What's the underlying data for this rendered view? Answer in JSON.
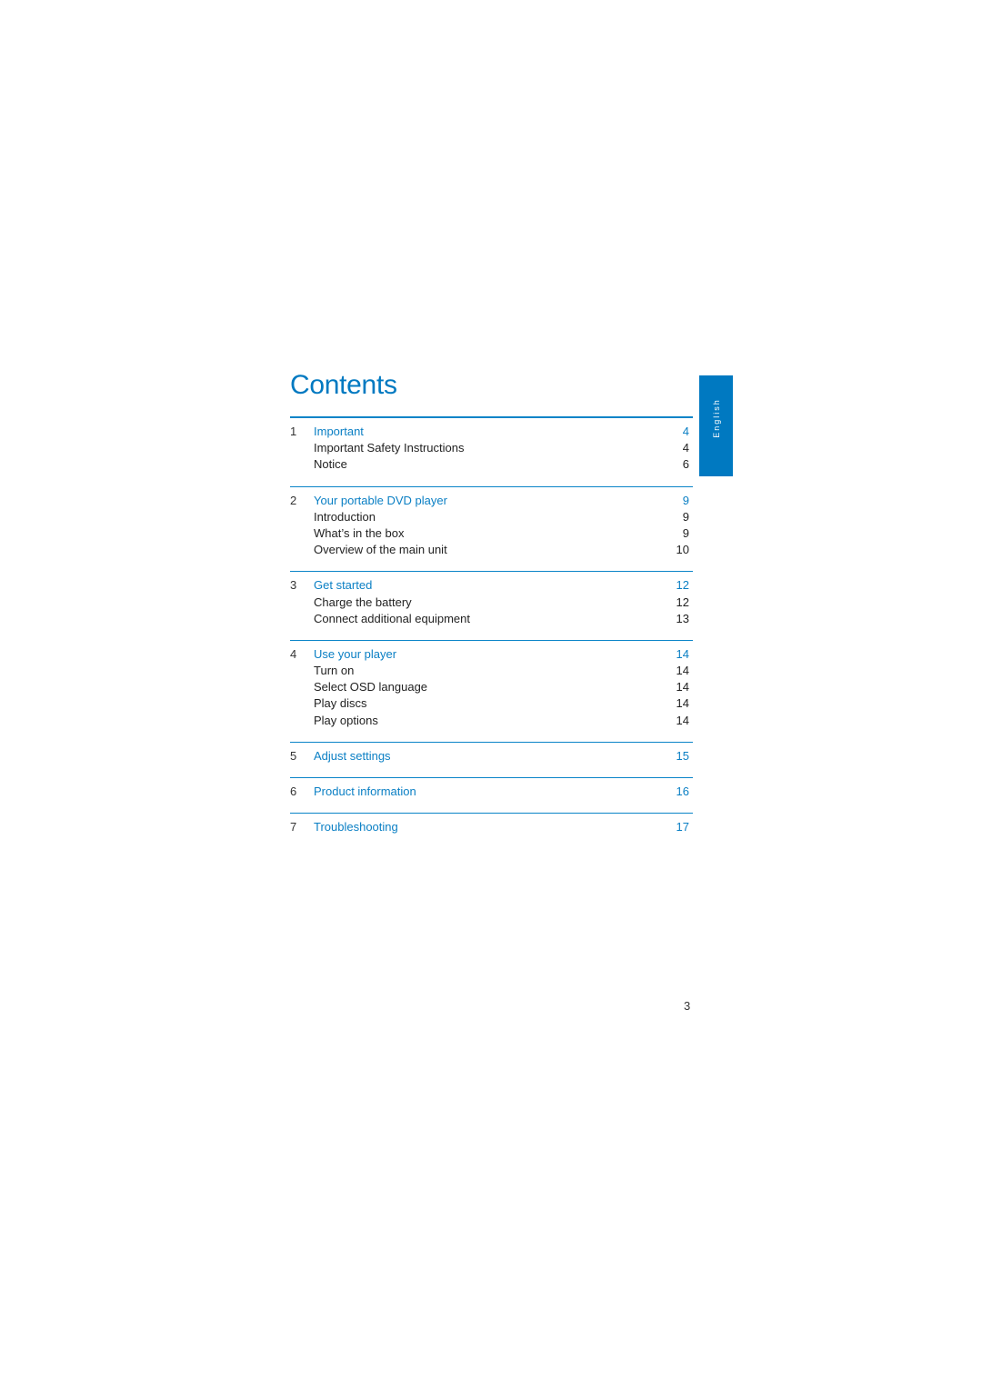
{
  "title": "Contents",
  "language_tab": "English",
  "page_number": "3",
  "colors": {
    "accent": "#0079c1",
    "text": "#222222"
  },
  "sections": [
    {
      "number": "1",
      "title": "Important",
      "page": "4",
      "items": [
        {
          "label": "Important Safety Instructions",
          "page": "4"
        },
        {
          "label": "Notice",
          "page": "6"
        }
      ]
    },
    {
      "number": "2",
      "title": "Your portable DVD player",
      "page": "9",
      "items": [
        {
          "label": "Introduction",
          "page": "9"
        },
        {
          "label": "What’s in the box",
          "page": "9"
        },
        {
          "label": "Overview of the main unit",
          "page": "10"
        }
      ]
    },
    {
      "number": "3",
      "title": "Get started",
      "page": "12",
      "items": [
        {
          "label": "Charge the battery",
          "page": "12"
        },
        {
          "label": "Connect additional equipment",
          "page": "13"
        }
      ]
    },
    {
      "number": "4",
      "title": "Use your player",
      "page": "14",
      "items": [
        {
          "label": "Turn on",
          "page": "14"
        },
        {
          "label": "Select OSD language",
          "page": "14"
        },
        {
          "label": "Play discs",
          "page": "14"
        },
        {
          "label": "Play options",
          "page": "14"
        }
      ]
    },
    {
      "number": "5",
      "title": "Adjust settings",
      "page": "15",
      "items": []
    },
    {
      "number": "6",
      "title": "Product information",
      "page": "16",
      "items": []
    },
    {
      "number": "7",
      "title": "Troubleshooting",
      "page": "17",
      "items": []
    }
  ]
}
